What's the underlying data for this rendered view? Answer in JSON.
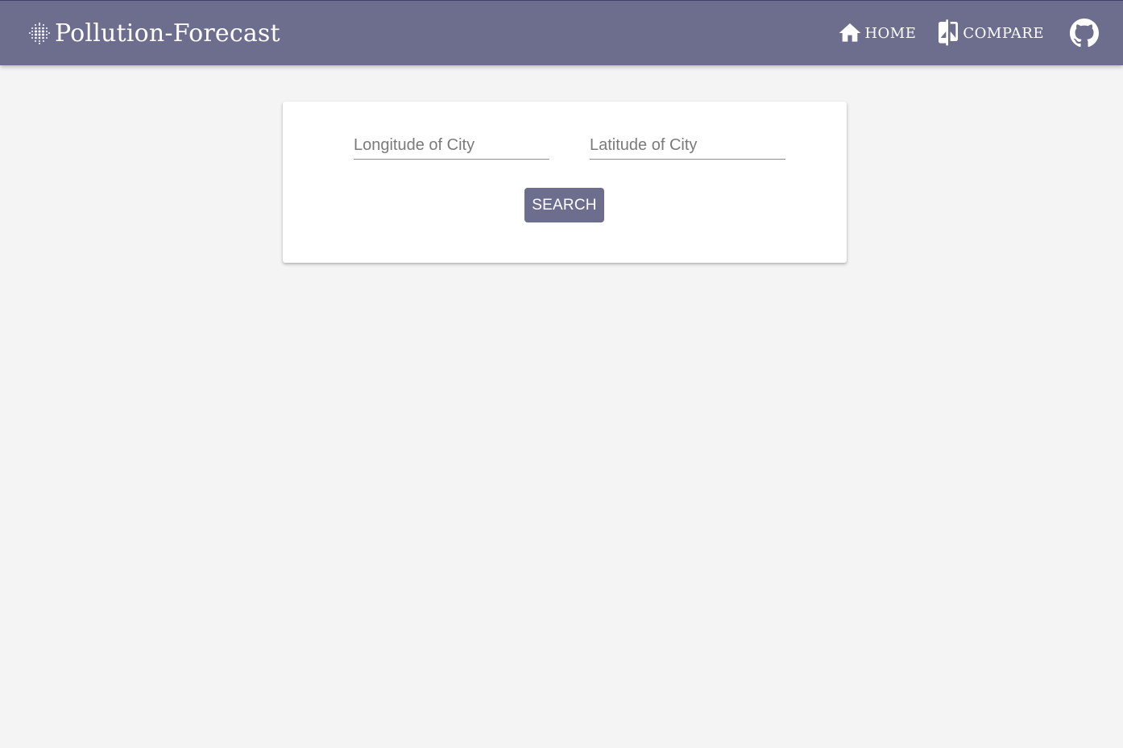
{
  "app": {
    "brand": "Pollution-Forecast",
    "brand_icon": "dotted-grid-logo-icon"
  },
  "nav": {
    "home_label": "HOME",
    "home_icon": "home-icon",
    "compare_label": "COMPARE",
    "compare_icon": "compare-icon",
    "github_icon": "github-icon"
  },
  "form": {
    "longitude": {
      "value": "",
      "placeholder": "Longitude of City"
    },
    "latitude": {
      "value": "",
      "placeholder": "Latitude of City"
    },
    "search_label": "SEARCH"
  },
  "colors": {
    "primary": "#6d6e8e",
    "background": "#f4f4f4",
    "card": "#ffffff"
  }
}
